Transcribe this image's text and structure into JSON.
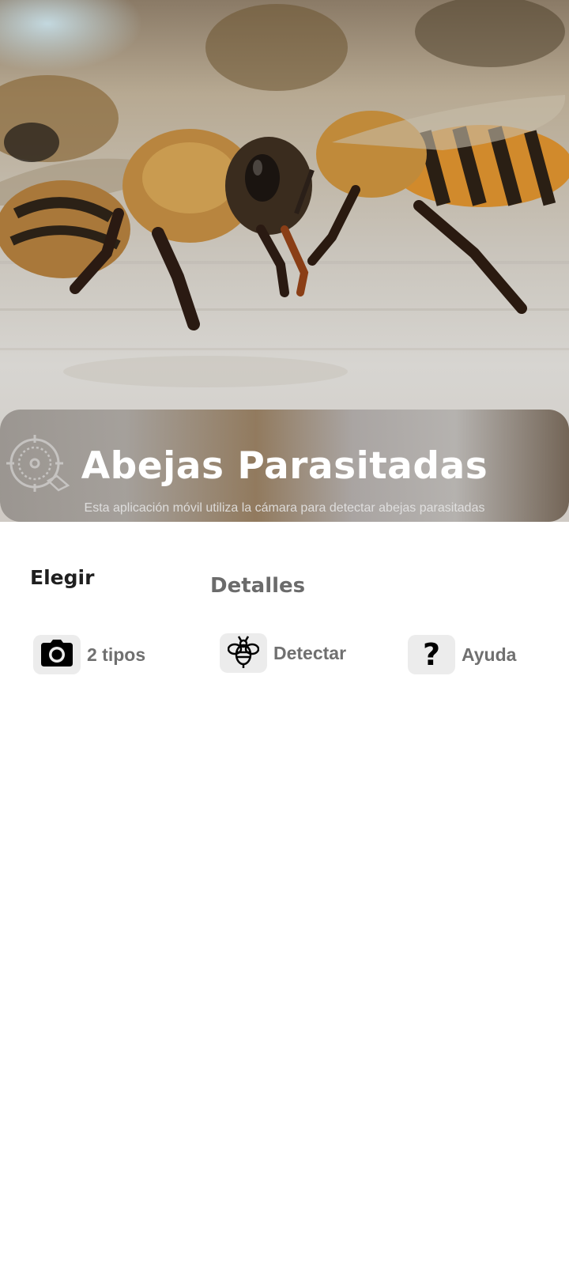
{
  "hero": {
    "image": "honeybee-closeup-photo",
    "title": "Abejas Parasitadas",
    "subtitle": "Esta aplicación móvil utiliza la cámara para detectar abejas parasitadas",
    "icon": "target-scan-icon"
  },
  "sections": {
    "left_heading": "Elegir",
    "right_heading": "Detalles"
  },
  "actions": [
    {
      "icon": "camera-icon",
      "label": "2 tipos"
    },
    {
      "icon": "bee-icon",
      "label": "Detectar"
    },
    {
      "icon": "question-icon",
      "label": "Ayuda"
    }
  ],
  "colors": {
    "icon_box_background": "#ececec",
    "action_label": "#707070",
    "heading_dark": "#1f1f1f",
    "heading_muted": "#6b6b6b"
  }
}
